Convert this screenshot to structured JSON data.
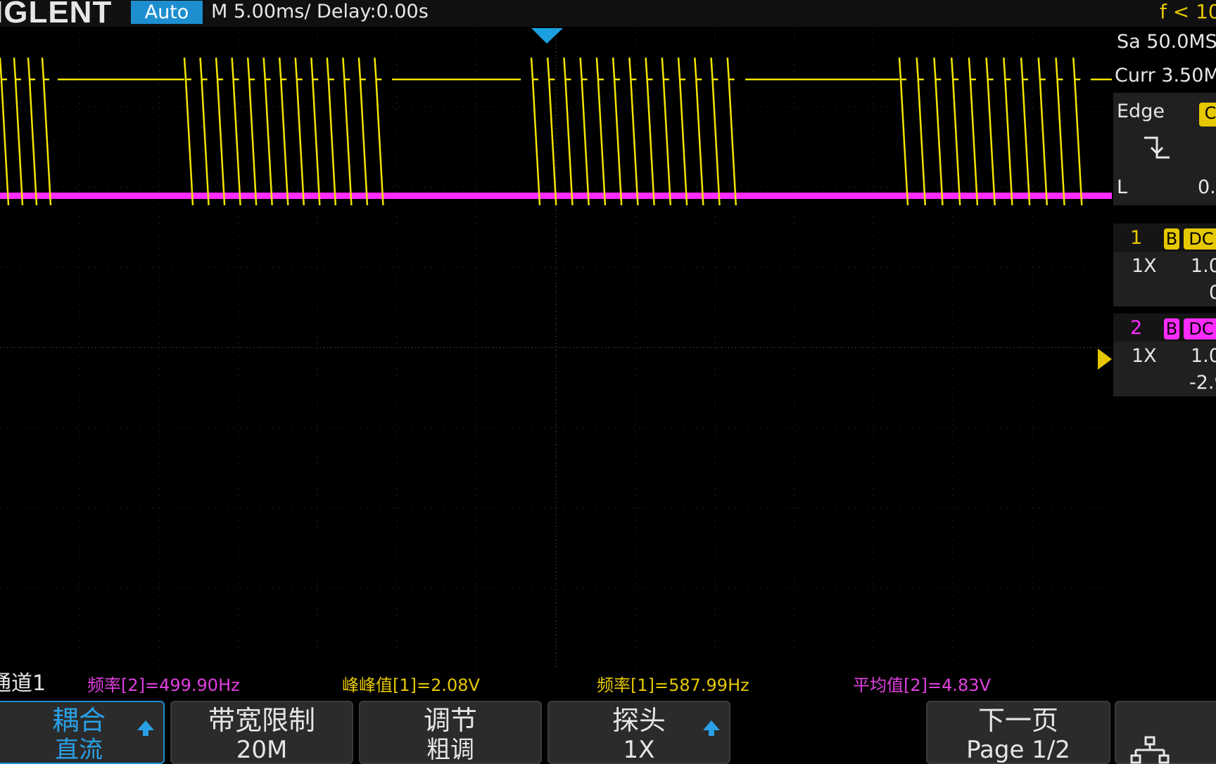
{
  "header": {
    "brand": "IGLENT",
    "mode": "Auto",
    "timebase": "M 5.00ms/ Delay:0.00s",
    "freq_indicator": "f < 10"
  },
  "info_panel": {
    "sample_rate": "Sa 50.0MS",
    "curr_depth": "Curr 3.50M",
    "trigger": {
      "type": "Edge",
      "source_badge": "C",
      "level_label": "L",
      "level_value": "0."
    },
    "channel1": {
      "number": "1",
      "bw_badge": "B",
      "coupling": "DC",
      "probe": "1X",
      "scale": "1.0",
      "offset": "0"
    },
    "channel2": {
      "number": "2",
      "bw_badge": "B",
      "coupling": "DC",
      "probe": "1X",
      "scale": "1.0",
      "offset": "-2.9"
    }
  },
  "measurements": {
    "channel_label": "通道1",
    "items": [
      {
        "text": "频率[2]=499.90Hz",
        "color": "#e040e0"
      },
      {
        "text": "峰峰值[1]=2.08V",
        "color": "#e6c800"
      },
      {
        "text": "频率[1]=587.99Hz",
        "color": "#e6c800"
      },
      {
        "text": "平均值[2]=4.83V",
        "color": "#e040e0"
      }
    ]
  },
  "softkeys": [
    {
      "line1": "耦合",
      "line2": "直流"
    },
    {
      "line1": "带宽限制",
      "line2": "20M"
    },
    {
      "line1": "调节",
      "line2": "粗调"
    },
    {
      "line1": "探头",
      "line2": "1X"
    },
    {
      "line1": "下一页",
      "line2": "Page 1/2"
    }
  ],
  "colors": {
    "channel1": "#f2e400",
    "channel2": "#ff2bff",
    "accent": "#1d8fd1"
  },
  "icons": {
    "trigger_edge": "falling-edge-icon",
    "network": "network-icon",
    "softkey_arrow": "up-arrow-icon"
  }
}
